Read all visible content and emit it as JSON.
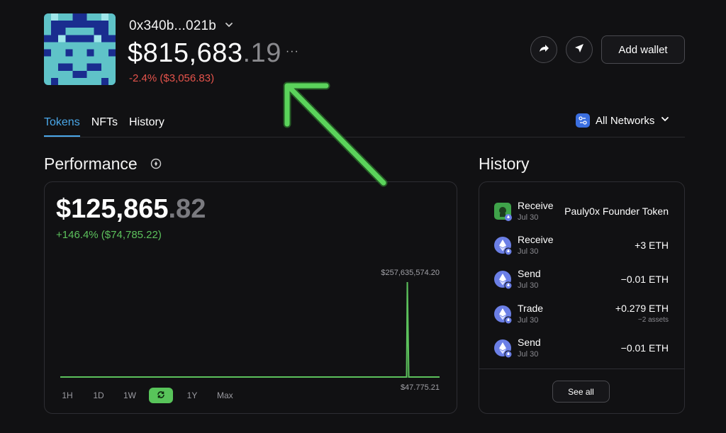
{
  "header": {
    "address": "0x340b...021b",
    "balance_main": "$815,683",
    "balance_cents": ".19",
    "more_label": "···",
    "change": "-2.4% ($3,056.83)",
    "add_wallet_label": "Add wallet"
  },
  "tabs": [
    {
      "label": "Tokens",
      "active": true
    },
    {
      "label": "NFTs",
      "active": false
    },
    {
      "label": "History",
      "active": false
    }
  ],
  "network_selector": {
    "label": "All Networks"
  },
  "performance": {
    "title": "Performance",
    "value_main": "$125,865",
    "value_cents": ".82",
    "change": "+146.4% ($74,785.22)",
    "ranges": [
      {
        "label": "1H",
        "active": false
      },
      {
        "label": "1D",
        "active": false
      },
      {
        "label": "1W",
        "active": false
      },
      {
        "label": "",
        "active": true,
        "icon": "refresh-icon"
      },
      {
        "label": "1Y",
        "active": false
      },
      {
        "label": "Max",
        "active": false
      }
    ]
  },
  "chart_data": {
    "type": "line",
    "series": [
      {
        "values": [
          47775.21,
          47775.21,
          47775.21,
          47775.21,
          47775.21,
          47775.21,
          47775.21,
          47775.21,
          47775.21,
          47775.21,
          257635574.2,
          47775.21,
          47775.21
        ]
      }
    ],
    "max_label": "$257,635,574.20",
    "min_label": "$47,775.21",
    "spike_position": 0.915,
    "line_color": "#5cc15c"
  },
  "history": {
    "title": "History",
    "items": [
      {
        "type": "Receive",
        "date": "Jul 30",
        "amount": "Pauly0x Founder Token",
        "sub": "",
        "icon": "nft-token-icon"
      },
      {
        "type": "Receive",
        "date": "Jul 30",
        "amount": "+3 ETH",
        "sub": "",
        "icon": "eth-icon"
      },
      {
        "type": "Send",
        "date": "Jul 30",
        "amount": "−0.01 ETH",
        "sub": "",
        "icon": "eth-icon"
      },
      {
        "type": "Trade",
        "date": "Jul 30",
        "amount": "+0.279 ETH",
        "sub": "−2 assets",
        "icon": "eth-icon"
      },
      {
        "type": "Send",
        "date": "Jul 30",
        "amount": "−0.01 ETH",
        "sub": "",
        "icon": "eth-icon"
      }
    ],
    "see_all_label": "See all"
  },
  "colors": {
    "background": "#111113",
    "accent_blue": "#4aa7e8",
    "positive": "#5cc15c",
    "negative": "#e5534b",
    "annotation_arrow": "#5bd35b"
  }
}
